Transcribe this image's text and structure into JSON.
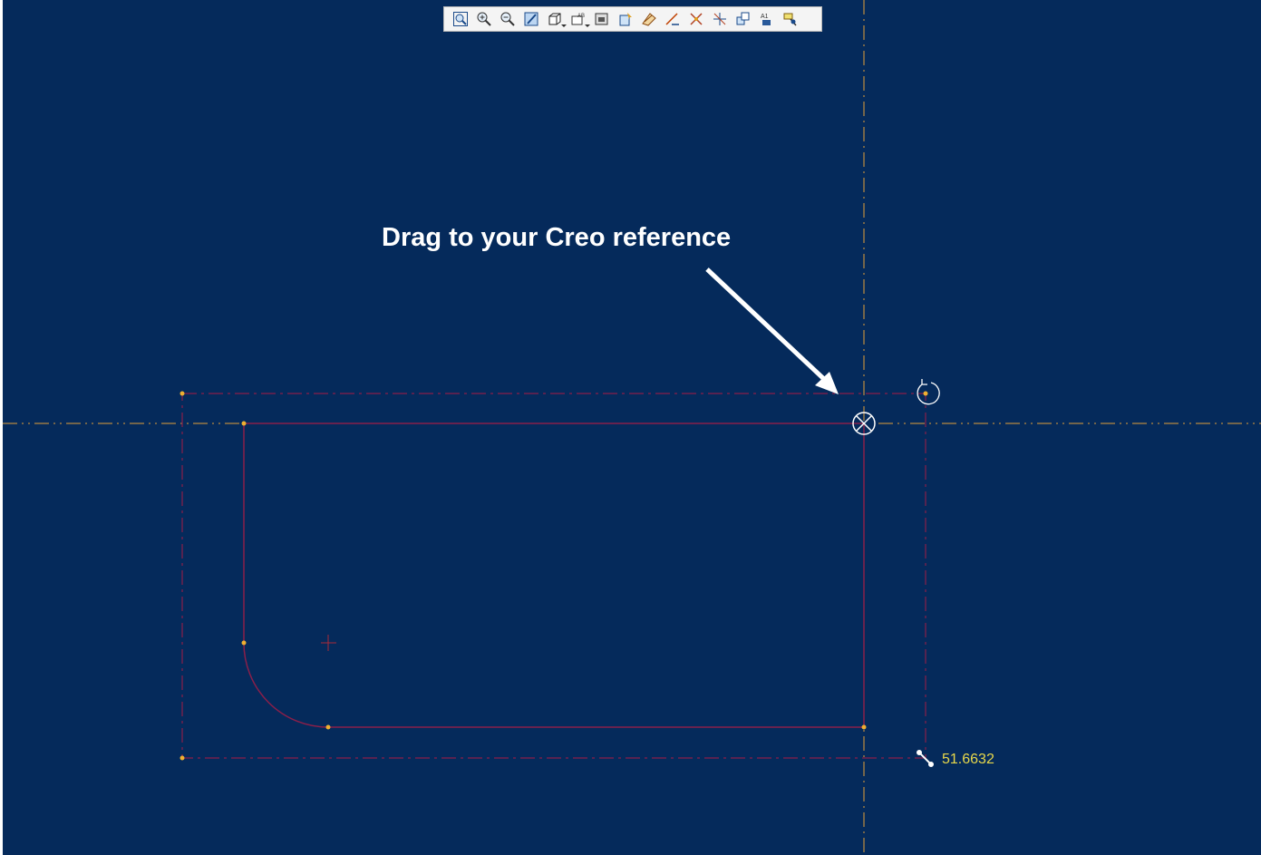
{
  "annotation": {
    "text": "Drag to your Creo reference"
  },
  "dimension": {
    "value": "51.6632"
  },
  "toolbar": {
    "buttons": [
      {
        "name": "refit-icon"
      },
      {
        "name": "zoom-in-icon"
      },
      {
        "name": "zoom-out-icon"
      },
      {
        "name": "repaint-icon"
      },
      {
        "name": "display-style-icon",
        "dropdown": true
      },
      {
        "name": "sketch-view-icon",
        "dropdown": true
      },
      {
        "name": "saved-orientations-icon"
      },
      {
        "name": "sketch-display-icon"
      },
      {
        "name": "dimension-display-icon"
      },
      {
        "name": "constraint-display-icon"
      },
      {
        "name": "grid-display-icon"
      },
      {
        "name": "vertex-display-icon"
      },
      {
        "name": "layers-icon"
      },
      {
        "name": "annotation-display-icon"
      },
      {
        "name": "axis-display-icon"
      },
      {
        "name": "point-display-icon"
      }
    ]
  },
  "colors": {
    "background": "#052a5b",
    "geometry": "#8a1f4a",
    "reference": "#e3a03a",
    "vertex": "#f0b030",
    "dimension": "#e8d84a",
    "annotation": "#ffffff"
  }
}
